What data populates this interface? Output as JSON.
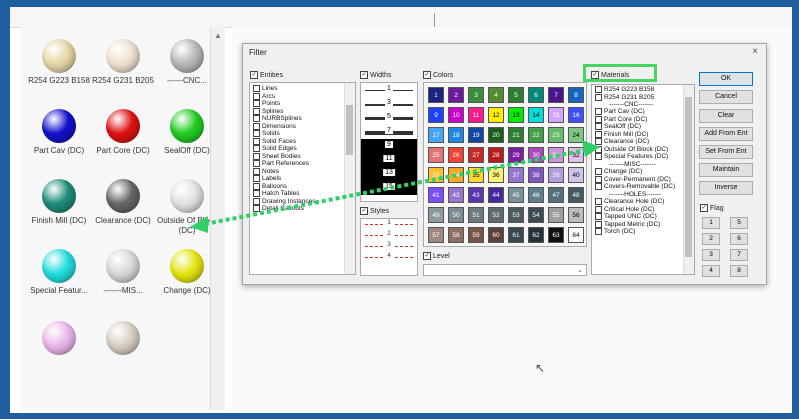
{
  "left_panel": {
    "balls": [
      {
        "label": "R254 G223 B158",
        "color": "#e6d7a8"
      },
      {
        "label": "R254 G231 B205",
        "color": "#eee1d0"
      },
      {
        "label": "------CNC...",
        "color": "#b8b8b8"
      },
      {
        "label": "Part Cav (DC)",
        "color": "#1111cc"
      },
      {
        "label": "Part Core (DC)",
        "color": "#dd1111"
      },
      {
        "label": "SealOff (DC)",
        "color": "#22cc22"
      },
      {
        "label": "Finish Mill (DC)",
        "color": "#1f8c7a"
      },
      {
        "label": "Clearance (DC)",
        "color": "#666666"
      },
      {
        "label": "Outside Of Block (DC)",
        "color": "#e2e2e2"
      },
      {
        "label": "Special Featur...",
        "color": "#22dddd"
      },
      {
        "label": "-------MIS...",
        "color": "#d8d8d8"
      },
      {
        "label": "Change (DC)",
        "color": "#e4e411"
      },
      {
        "label": "",
        "color": "#e9b6e9"
      },
      {
        "label": "",
        "color": "#d8cfc2"
      }
    ]
  },
  "dialog": {
    "title": "Filter",
    "close": "×",
    "entities": {
      "label": "Entities",
      "items": [
        "Lines",
        "Arcs",
        "Points",
        "Splines",
        "NURBSplines",
        "Dimensions",
        "Solids",
        "Solid Faces",
        "Solid Edges",
        "Sheet Bodies",
        "Part References",
        "Notes",
        "Labels",
        "Balloons",
        "Hatch Tables",
        "Drawing Instances",
        "Detail Callouts"
      ]
    },
    "widths": {
      "label": "Widths",
      "items": [
        "1",
        "3",
        "5",
        "7",
        "9",
        "11",
        "13",
        "15"
      ]
    },
    "styles": {
      "label": "Styles",
      "items": [
        "1",
        "2",
        "3",
        "4"
      ]
    },
    "colors": {
      "label": "Colors",
      "cells": [
        {
          "n": "1",
          "c": "#1a237e"
        },
        {
          "n": "2",
          "c": "#6a1b9a"
        },
        {
          "n": "3",
          "c": "#388e3c"
        },
        {
          "n": "4",
          "c": "#558b2f"
        },
        {
          "n": "5",
          "c": "#2e7d32"
        },
        {
          "n": "6",
          "c": "#00897b"
        },
        {
          "n": "7",
          "c": "#4a148c"
        },
        {
          "n": "8",
          "c": "#1565c0"
        },
        {
          "n": "9",
          "c": "#1e40ff"
        },
        {
          "n": "10",
          "c": "#cc00cc"
        },
        {
          "n": "11",
          "c": "#ff1a8c"
        },
        {
          "n": "12",
          "c": "#ffee00"
        },
        {
          "n": "13",
          "c": "#00ee00"
        },
        {
          "n": "14",
          "c": "#00dddd"
        },
        {
          "n": "15",
          "c": "#d4a5ff"
        },
        {
          "n": "16",
          "c": "#3f51ff"
        },
        {
          "n": "17",
          "c": "#42a5f5"
        },
        {
          "n": "18",
          "c": "#1e88e5"
        },
        {
          "n": "19",
          "c": "#0d47a1"
        },
        {
          "n": "20",
          "c": "#1b5e20"
        },
        {
          "n": "21",
          "c": "#2e7d32"
        },
        {
          "n": "22",
          "c": "#43a047"
        },
        {
          "n": "23",
          "c": "#66bb6a"
        },
        {
          "n": "24",
          "c": "#81c784"
        },
        {
          "n": "25",
          "c": "#e57373"
        },
        {
          "n": "26",
          "c": "#f44336"
        },
        {
          "n": "27",
          "c": "#c62828"
        },
        {
          "n": "28",
          "c": "#b71c1c"
        },
        {
          "n": "29",
          "c": "#7b1fa2"
        },
        {
          "n": "30",
          "c": "#ab47bc"
        },
        {
          "n": "31",
          "c": "#ce93d8"
        },
        {
          "n": "32",
          "c": "#e1bee7"
        },
        {
          "n": "33",
          "c": "#fbc02d"
        },
        {
          "n": "34",
          "c": "#f9a825"
        },
        {
          "n": "35",
          "c": "#fdd835"
        },
        {
          "n": "36",
          "c": "#fff176"
        },
        {
          "n": "37",
          "c": "#9575cd"
        },
        {
          "n": "38",
          "c": "#7e57c2"
        },
        {
          "n": "39",
          "c": "#b39ddb"
        },
        {
          "n": "40",
          "c": "#d1c4e9"
        },
        {
          "n": "41",
          "c": "#7c4dff"
        },
        {
          "n": "42",
          "c": "#9575cd"
        },
        {
          "n": "43",
          "c": "#5e35b1"
        },
        {
          "n": "44",
          "c": "#4527a0"
        },
        {
          "n": "45",
          "c": "#78909c"
        },
        {
          "n": "46",
          "c": "#607d8b"
        },
        {
          "n": "47",
          "c": "#546e7a"
        },
        {
          "n": "48",
          "c": "#455a64"
        },
        {
          "n": "49",
          "c": "#8d9aa0"
        },
        {
          "n": "50",
          "c": "#7d8a90"
        },
        {
          "n": "51",
          "c": "#6d7a80"
        },
        {
          "n": "52",
          "c": "#5d6a70"
        },
        {
          "n": "53",
          "c": "#4d5a60"
        },
        {
          "n": "54",
          "c": "#3d4a50"
        },
        {
          "n": "55",
          "c": "#9e9e9e"
        },
        {
          "n": "56",
          "c": "#bdbdbd"
        },
        {
          "n": "57",
          "c": "#a1887f"
        },
        {
          "n": "58",
          "c": "#8d6e63"
        },
        {
          "n": "59",
          "c": "#795548"
        },
        {
          "n": "60",
          "c": "#5d4037"
        },
        {
          "n": "61",
          "c": "#37474f"
        },
        {
          "n": "62",
          "c": "#263238"
        },
        {
          "n": "63",
          "c": "#111111"
        },
        {
          "n": "64",
          "c": "#ffffff"
        }
      ]
    },
    "level": {
      "label": "Level"
    },
    "materials": {
      "label": "Materials",
      "items": [
        "R254 G223 B158",
        "R254 G231 B205",
        "-------CNC-------",
        "Part Cav (DC)",
        "Part Core (DC)",
        "SealOff (DC)",
        "Finish Mill (DC)",
        "Clearance (DC)",
        "Outside Of Block (DC)",
        "Special Features (DC)",
        "-------MISC-------",
        "Change (DC)",
        "Cover-Permanent (DC)",
        "Covers-Removable (DC)",
        "-------HOLES-------",
        "Clearance Hole (DC)",
        "Critical Hole (DC)",
        "Tapped UNC (DC)",
        "Tapped Metric (DC)",
        "Torch (DC)"
      ]
    },
    "buttons": {
      "ok": "OK",
      "cancel": "Cancel",
      "clear": "Clear",
      "add_from_ent": "Add From Ent",
      "set_from_ent": "Set From Ent",
      "maintain": "Maintain",
      "inverse": "Inverse"
    },
    "flag": {
      "label": "Flag",
      "items": [
        "1",
        "5",
        "2",
        "6",
        "3",
        "7",
        "4",
        "8"
      ]
    }
  }
}
